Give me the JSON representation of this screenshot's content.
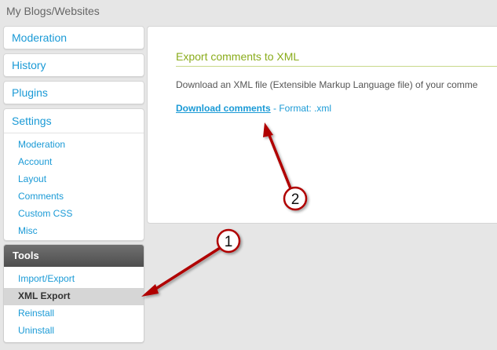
{
  "page": {
    "title": "My Blogs/Websites"
  },
  "sidebar": {
    "nav": [
      {
        "label": "Moderation"
      },
      {
        "label": "History"
      },
      {
        "label": "Plugins"
      }
    ],
    "settings": {
      "label": "Settings",
      "items": [
        "Moderation",
        "Account",
        "Layout",
        "Comments",
        "Custom CSS",
        "Misc"
      ]
    },
    "tools": {
      "label": "Tools",
      "items": [
        "Import/Export",
        "XML Export",
        "Reinstall",
        "Uninstall"
      ],
      "active": "XML Export"
    }
  },
  "main": {
    "section_title": "Export comments to XML",
    "description": "Download an XML file (Extensible Markup Language file) of your comme",
    "download_link": "Download comments",
    "download_format": " - Format: .xml"
  },
  "annotations": {
    "marker1": "1",
    "marker2": "2",
    "arrow_color": "#b00000"
  },
  "colors": {
    "link": "#1a9ad6",
    "section_title": "#8aac1c",
    "tools_header": "#5a5a5a"
  }
}
